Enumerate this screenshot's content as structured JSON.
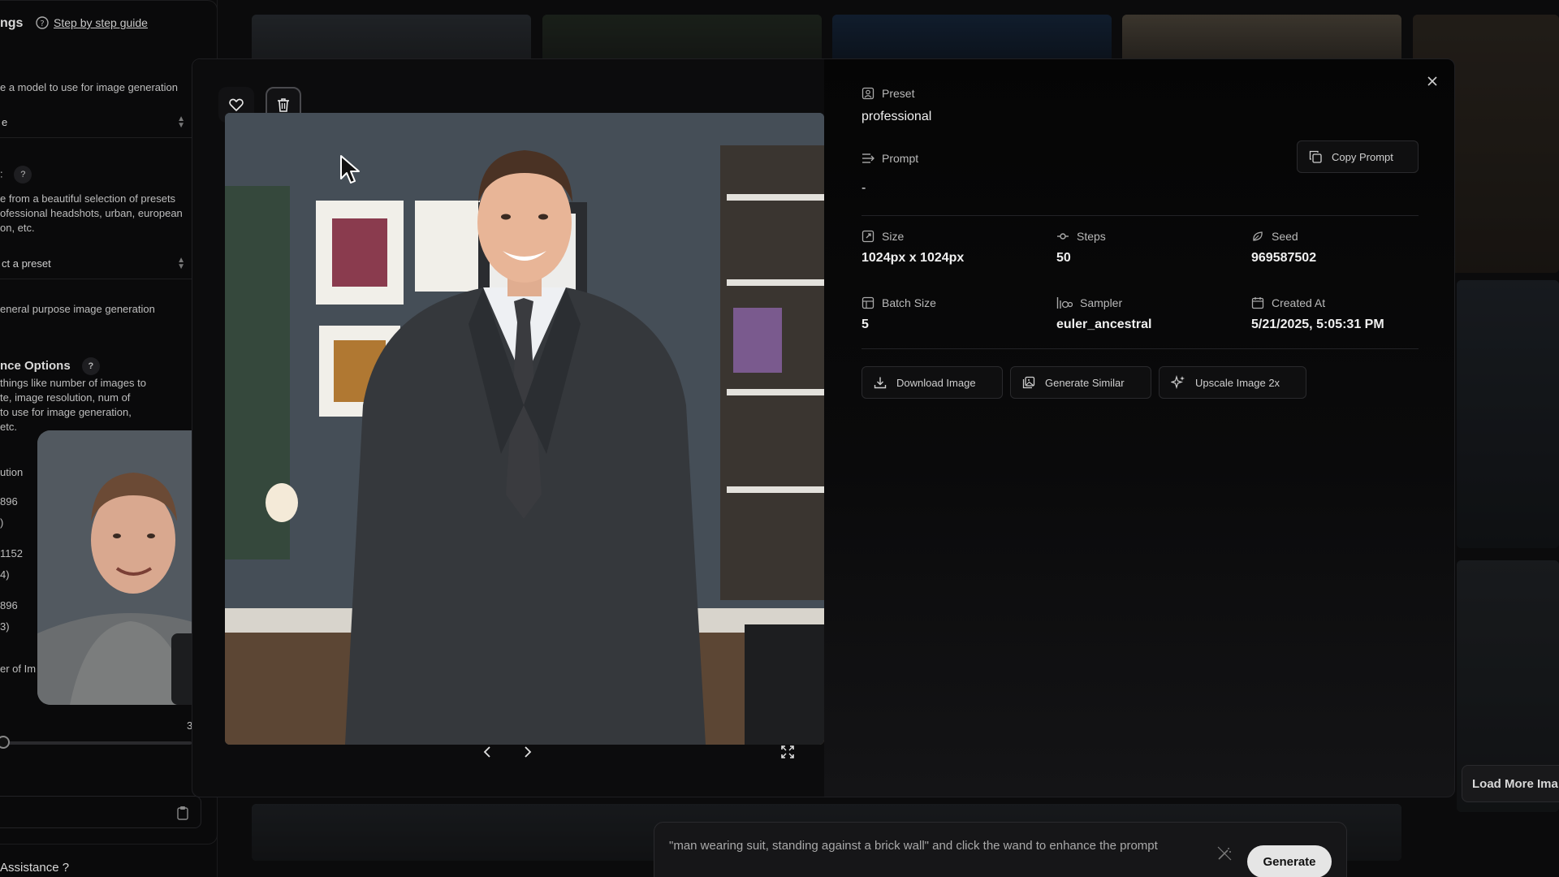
{
  "background": {
    "panel": {
      "title_partial": "ngs",
      "guide_link": "Step by step guide",
      "model_desc": "e a model to use for image generation",
      "model_select": "e",
      "preset_label": ":",
      "preset_desc_1": "e from a beautiful selection of presets",
      "preset_desc_2": "ofessional headshots, urban, european",
      "preset_desc_3": "on, etc.",
      "preset_select": "ct a preset",
      "purpose": "eneral purpose image generation",
      "advanced_title": "nce Options",
      "advanced_desc_1": "things like number of images to",
      "advanced_desc_2": "te, image resolution, num of",
      "advanced_desc_3": "to use for image generation,",
      "advanced_desc_4": "etc.",
      "resolution_label": "ution",
      "res_1a": "896",
      "res_1b": ")",
      "res_2a": "1152",
      "res_2b": "4)",
      "res_3a": "896",
      "res_3b": "3)",
      "num_images_label": "er of Im",
      "slider_max": "3",
      "assistance": "Assistance ?"
    },
    "gallery": {
      "load_more": "Load More Ima"
    },
    "prompt_bar": {
      "text": "\"man wearing suit, standing against a brick wall\" and click the wand to enhance the prompt",
      "generate": "Generate"
    }
  },
  "modal": {
    "preset": {
      "label": "Preset",
      "value": "professional"
    },
    "prompt": {
      "label": "Prompt",
      "value": "-",
      "copy_label": "Copy Prompt"
    },
    "size": {
      "label": "Size",
      "value": "1024px x 1024px"
    },
    "steps": {
      "label": "Steps",
      "value": "50"
    },
    "seed": {
      "label": "Seed",
      "value": "969587502"
    },
    "batch_size": {
      "label": "Batch Size",
      "value": "5"
    },
    "sampler": {
      "label": "Sampler",
      "value": "euler_ancestral"
    },
    "created_at": {
      "label": "Created At",
      "value": "5/21/2025, 5:05:31 PM"
    },
    "actions": {
      "download": "Download Image",
      "similar": "Generate Similar",
      "upscale": "Upscale Image 2x"
    }
  }
}
